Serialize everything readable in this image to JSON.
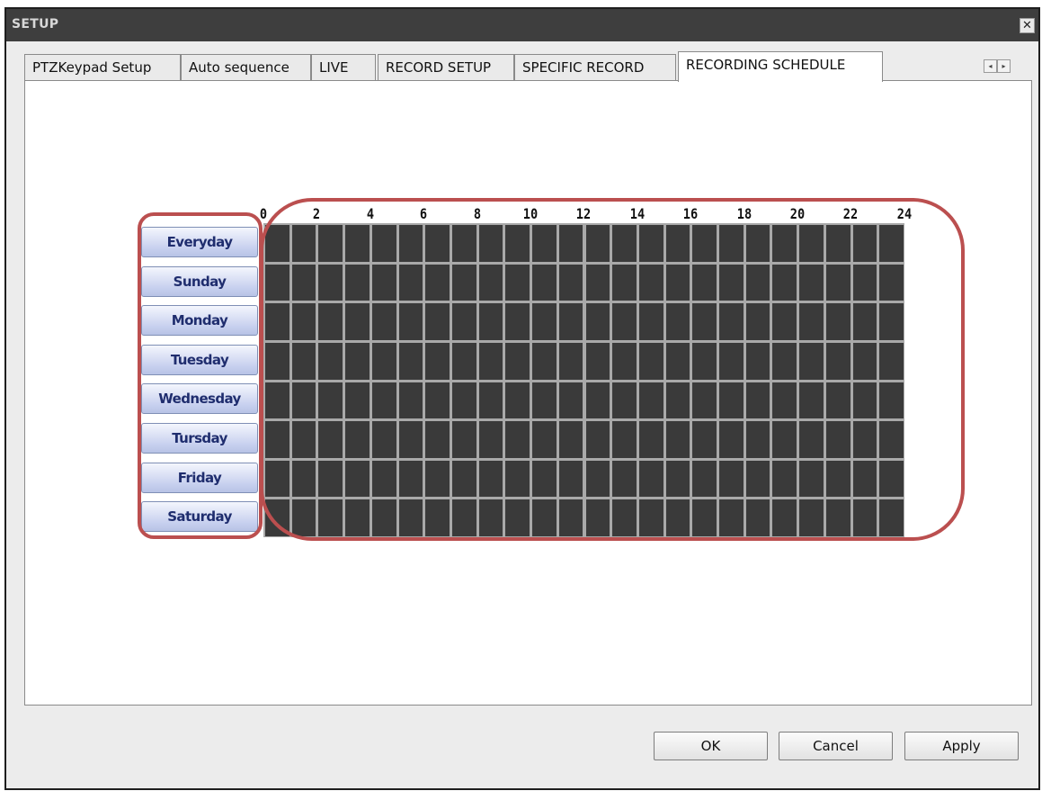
{
  "window": {
    "title": "SETUP",
    "close_icon": "close-icon"
  },
  "tabs": [
    "PTZKeypad Setup",
    "Auto sequence",
    "LIVE",
    "RECORD SETUP",
    "SPECIFIC RECORD",
    "RECORDING SCHEDULE"
  ],
  "active_tab": "RECORDING SCHEDULE",
  "tab_nav": {
    "prev": "◂",
    "next": "▸"
  },
  "schedule": {
    "days": [
      "Everyday",
      "Sunday",
      "Monday",
      "Tuesday",
      "Wednesday",
      "Tursday",
      "Friday",
      "Saturday"
    ],
    "hour_labels": [
      "0",
      "2",
      "4",
      "6",
      "8",
      "10",
      "12",
      "14",
      "16",
      "18",
      "20",
      "22",
      "24"
    ],
    "hours_per_row": 24,
    "cell_color": "#3a3a3a",
    "grid_line_color": "#a9a9a9",
    "highlight_color": "#bb4f4f"
  },
  "buttons": {
    "ok": "OK",
    "cancel": "Cancel",
    "apply": "Apply"
  }
}
